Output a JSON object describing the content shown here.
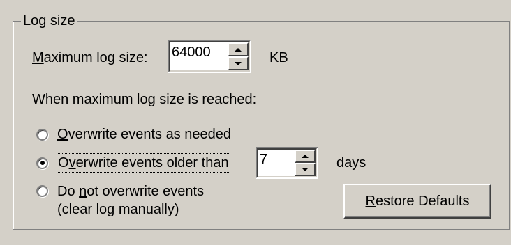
{
  "group": {
    "title": "Log size"
  },
  "max_size": {
    "label_prefix": "",
    "label_mnemonic": "M",
    "label_rest": "aximum log size:",
    "value": "64000",
    "unit": "KB"
  },
  "when_reached_text": "When maximum log size is reached:",
  "options": {
    "overwrite_as_needed": {
      "mnemonic": "O",
      "rest": "verwrite events as needed",
      "selected": false
    },
    "overwrite_older": {
      "prefix": "O",
      "mnemonic": "v",
      "rest": "erwrite events older than",
      "selected": true,
      "days_value": "7",
      "days_unit": "days"
    },
    "do_not_overwrite": {
      "line1_prefix": "Do ",
      "line1_mnemonic": "n",
      "line1_rest": "ot overwrite events",
      "line2": "(clear log manually)",
      "selected": false
    }
  },
  "restore_button": {
    "mnemonic": "R",
    "rest": "estore Defaults"
  }
}
